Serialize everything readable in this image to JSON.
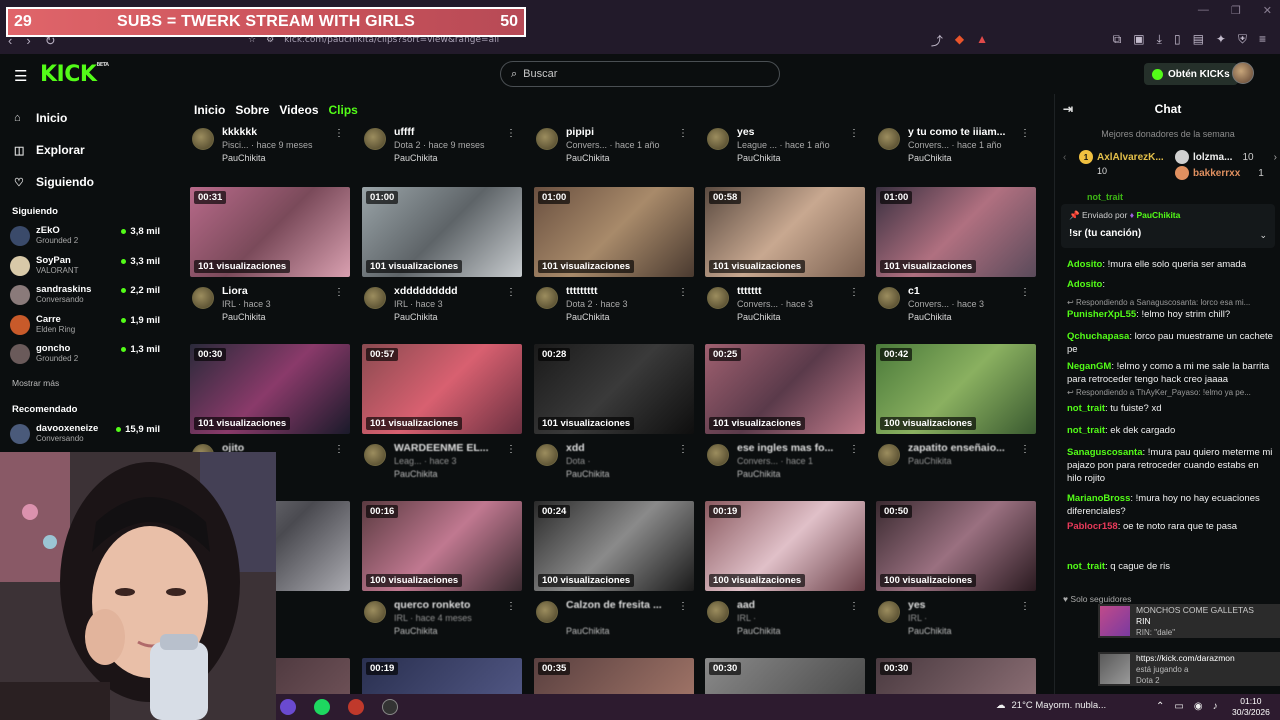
{
  "overlay": {
    "left_number": "29",
    "text": "SUBS = TWERK STREAM WITH GIRLS",
    "right_number": "50"
  },
  "browser": {
    "url": "kick.com/pauchikita/clips?sort=view&range=all"
  },
  "header": {
    "logo": "KICK",
    "logo_sup": "BETA",
    "search_placeholder": "Buscar",
    "get_kicks": "Obtén KICKs"
  },
  "sidebar": {
    "nav": [
      {
        "label": "Inicio",
        "icon": "home-icon"
      },
      {
        "label": "Explorar",
        "icon": "compass-icon"
      },
      {
        "label": "Siguiendo",
        "icon": "heart-icon"
      }
    ],
    "following_title": "Siguiendo",
    "following": [
      {
        "name": "zEkO",
        "game": "Grounded 2",
        "viewers": "3,8 mil",
        "color": "#3a4a6a"
      },
      {
        "name": "SoyPan",
        "game": "VALORANT",
        "viewers": "3,3 mil",
        "color": "#d8c9a8"
      },
      {
        "name": "sandraskins",
        "game": "Conversando",
        "viewers": "2,2 mil",
        "color": "#8a7a7a"
      },
      {
        "name": "Carre",
        "game": "Elden Ring",
        "viewers": "1,9 mil",
        "color": "#c85a2a"
      },
      {
        "name": "goncho",
        "game": "Grounded 2",
        "viewers": "1,3 mil",
        "color": "#6a5a5a"
      }
    ],
    "show_more": "Mostrar más",
    "recommended_title": "Recomendado",
    "recommended": [
      {
        "name": "davooxeneize",
        "game": "Conversando",
        "viewers": "15,9 mil",
        "color": "#4a5a7a"
      }
    ]
  },
  "tabs": [
    "Inicio",
    "Sobre",
    "Videos",
    "Clips"
  ],
  "grid": {
    "top_meta": [
      {
        "title": "kkkkkk",
        "sub": "Pisci... · hace 9 meses",
        "chan": "PauChikita"
      },
      {
        "title": "uffff",
        "sub": "Dota 2 · hace 9 meses",
        "chan": "PauChikita"
      },
      {
        "title": "pipipi",
        "sub": "Convers... · hace 1 año",
        "chan": "PauChikita"
      },
      {
        "title": "yes",
        "sub": "League ... · hace 1 año",
        "chan": "PauChikita"
      },
      {
        "title": "y tu como te iiiam...",
        "sub": "Convers... · hace 1 año",
        "chan": "PauChikita"
      }
    ],
    "rows": [
      [
        {
          "dur": "00:31",
          "views": "101 visualizaciones",
          "title": "Liora",
          "sub": "IRL · hace 3",
          "chan": "PauChikita",
          "bg": "linear-gradient(135deg,#b86a8a,#7a4a5a 50%,#d9a0b0)"
        },
        {
          "dur": "01:00",
          "views": "101 visualizaciones",
          "title": "xddddddddd",
          "sub": "IRL · hace 3",
          "chan": "PauChikita",
          "bg": "linear-gradient(135deg,#9aa4a8,#5e6468 50%,#c8cccf)"
        },
        {
          "dur": "01:00",
          "views": "101 visualizaciones",
          "title": "ttttttttt",
          "sub": "Dota 2 · hace 3",
          "chan": "PauChikita",
          "bg": "linear-gradient(135deg,#6a5040,#a88a6a 50%,#4a3a30)"
        },
        {
          "dur": "00:58",
          "views": "101 visualizaciones",
          "title": "ttttttt",
          "sub": "Convers... · hace 3",
          "chan": "PauChikita",
          "bg": "linear-gradient(135deg,#5a4a40,#c8a890 50%,#7a6050)"
        },
        {
          "dur": "01:00",
          "views": "101 visualizaciones",
          "title": "c1",
          "sub": "Convers... · hace 3",
          "chan": "PauChikita",
          "bg": "linear-gradient(135deg,#3a3040,#b07080 50%,#5a4a5a)"
        }
      ],
      [
        {
          "dur": "00:30",
          "views": "101 visualizaciones",
          "title": "ojito",
          "sub": "",
          "chan": "",
          "bg": "linear-gradient(135deg,#2a2a3a,#8a3a6a 50%,#1a1a2a)"
        },
        {
          "dur": "00:57",
          "views": "101 visualizaciones",
          "title": "WARDEENME EL...",
          "sub": "Leag... · hace 3",
          "chan": "PauChikita",
          "bg": "linear-gradient(135deg,#8a4a50,#d86070 50%,#6a3040)"
        },
        {
          "dur": "00:28",
          "views": "101 visualizaciones",
          "title": "xdd",
          "sub": "Dota ·",
          "chan": "PauChikita",
          "bg": "linear-gradient(135deg,#1a1a1a,#3a3a3a 50%,#0e0e0e)"
        },
        {
          "dur": "00:25",
          "views": "101 visualizaciones",
          "title": "ese ingles mas fo...",
          "sub": "Convers... · hace 1",
          "chan": "PauChikita",
          "bg": "linear-gradient(135deg,#a06070,#5a3a4a 50%,#c07a8a)"
        },
        {
          "dur": "00:42",
          "views": "100 visualizaciones",
          "title": "zapatito enseñaio...",
          "sub": "PauChikita",
          "chan": "",
          "bg": "linear-gradient(135deg,#4a7a3a,#8ab060 50%,#3a5a30)"
        }
      ],
      [
        {
          "dur": "",
          "views": "",
          "title": "",
          "sub": "",
          "chan": "",
          "bg": "linear-gradient(135deg,#8a8a90,#4a4a50 50%,#aaaab0)"
        },
        {
          "dur": "00:16",
          "views": "100 visualizaciones",
          "title": "querco ronketo",
          "sub": "IRL · hace 4 meses",
          "chan": "PauChikita",
          "bg": "linear-gradient(135deg,#5a3a40,#c07890 50%,#3a2a30)"
        },
        {
          "dur": "00:24",
          "views": "100 visualizaciones",
          "title": "Calzon de fresita ...",
          "sub": "",
          "chan": "PauChikita",
          "bg": "linear-gradient(135deg,#2a2a2a,#8a8a8a 50%,#1a1a1a)"
        },
        {
          "dur": "00:19",
          "views": "100 visualizaciones",
          "title": "aad",
          "sub": "IRL ·",
          "chan": "PauChikita",
          "bg": "linear-gradient(135deg,#8a5a60,#e0c0c8 50%,#6a4048)"
        },
        {
          "dur": "00:50",
          "views": "100 visualizaciones",
          "title": "yes",
          "sub": "IRL ·",
          "chan": "PauChikita",
          "bg": "linear-gradient(135deg,#3a2a30,#9a7080 50%,#2a1a20)"
        }
      ],
      [
        {
          "dur": "",
          "views": "",
          "title": "",
          "sub": "",
          "chan": "",
          "bg": "linear-gradient(135deg,#3a2a30,#7a5a60)"
        },
        {
          "dur": "00:19",
          "views": "",
          "title": "",
          "sub": "",
          "chan": "",
          "bg": "linear-gradient(135deg,#2a3050,#5a6090)"
        },
        {
          "dur": "00:35",
          "views": "",
          "title": "",
          "sub": "",
          "chan": "",
          "bg": "linear-gradient(135deg,#5a4040,#b08070)"
        },
        {
          "dur": "00:30",
          "views": "",
          "title": "",
          "sub": "",
          "chan": "",
          "bg": "linear-gradient(135deg,#8a8a8a,#3a3a3a)"
        },
        {
          "dur": "00:30",
          "views": "",
          "title": "",
          "sub": "",
          "chan": "",
          "bg": "linear-gradient(135deg,#4a3a40,#9a7a80)"
        }
      ]
    ]
  },
  "chat": {
    "title": "Chat",
    "donors_title": "Mejores donadores de la semana",
    "donors": [
      {
        "rank": "1",
        "name": "AxlAlvarezK...",
        "amount": "10",
        "color": "#f0c040"
      },
      {
        "rank": "",
        "name": "lolzma...",
        "amount": "10",
        "color": "#d0d0d0"
      },
      {
        "rank": "",
        "name": "bakkerrxx",
        "amount": "1",
        "color": "#e09060"
      }
    ],
    "donor_partial": "not_trait",
    "pinned_by_prefix": "Enviado por",
    "pinned_user": "PauChikita",
    "pinned_msg": "!sr (tu canción)",
    "messages": [
      {
        "user": "Adosito",
        "color": "#53fc18",
        "text": "!mura elle solo queria ser amada"
      },
      {
        "user": "Adosito",
        "color": "#53fc18",
        "text": ""
      },
      {
        "reply": "Respondiendo a Sanaguscosanta: lorco esa mi..."
      },
      {
        "user": "PunisherXpL55",
        "color": "#53fc18",
        "text": "!elmo hoy strim chill?"
      },
      {
        "user": "Qchuchapasa",
        "color": "#53fc18",
        "text": "lorco pau muestrame un cachete pe"
      },
      {
        "user": "NeganGM",
        "color": "#53fc18",
        "text": "!elmo y como a mi me sale la barrita para retroceder tengo hack creo jaaaa"
      },
      {
        "reply": "Respondiendo a ThAyKer_Payaso: !elmo ya pe..."
      },
      {
        "user": "not_trait",
        "color": "#53fc18",
        "text": "tu fuiste? xd"
      },
      {
        "user": "not_trait",
        "color": "#53fc18",
        "text": "ek dek cargado"
      },
      {
        "user": "Sanaguscosanta",
        "color": "#53fc18",
        "text": "!mura pau quiero meterme mi pajazo pon para retroceder cuando estabs en hilo rojito"
      },
      {
        "user": "MarianoBross",
        "color": "#53fc18",
        "text": "!mura hoy no hay ecuaciones diferenciales?"
      },
      {
        "user": "Pablocr158",
        "color": "#e83a5a",
        "text": "oe te noto rara que te pasa"
      },
      {
        "user": "not_trait",
        "color": "#53fc18",
        "text": "q cague de ris"
      }
    ],
    "followers_only": "Solo seguidores"
  },
  "notifications": [
    {
      "a": "MONCHOS COME GALLETAS",
      "b": "RIN",
      "c": "RIN: \"dale\""
    },
    {
      "a": "https://kick.com/darazmon",
      "b": "está jugando a",
      "c": "Dota 2"
    }
  ],
  "taskbar": {
    "weather": "21°C  Mayorm. nubla...",
    "time": "01:10",
    "date": "30/3/2026"
  }
}
